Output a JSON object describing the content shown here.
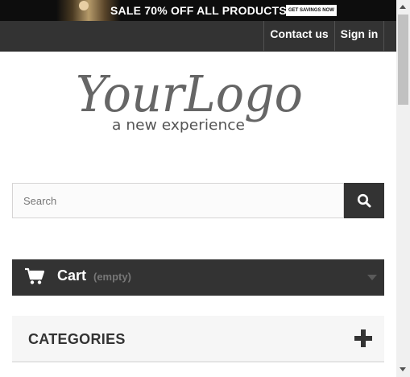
{
  "banner": {
    "text": "SALE 70% OFF ALL PRODUCTS",
    "button": "GET SAVINGS NOW"
  },
  "nav": {
    "contact": "Contact us",
    "signin": "Sign in"
  },
  "logo": {
    "script_text": "YourLogo",
    "tagline": "a new experience"
  },
  "search": {
    "placeholder": "Search",
    "icon": "search-icon"
  },
  "cart": {
    "label": "Cart",
    "quantity_text": "(empty)",
    "icon": "shopping-cart-icon"
  },
  "categories": {
    "label": "CATEGORIES",
    "icon": "plus-icon"
  },
  "colors": {
    "dark": "#333333",
    "light_panel": "#f6f6f6"
  }
}
